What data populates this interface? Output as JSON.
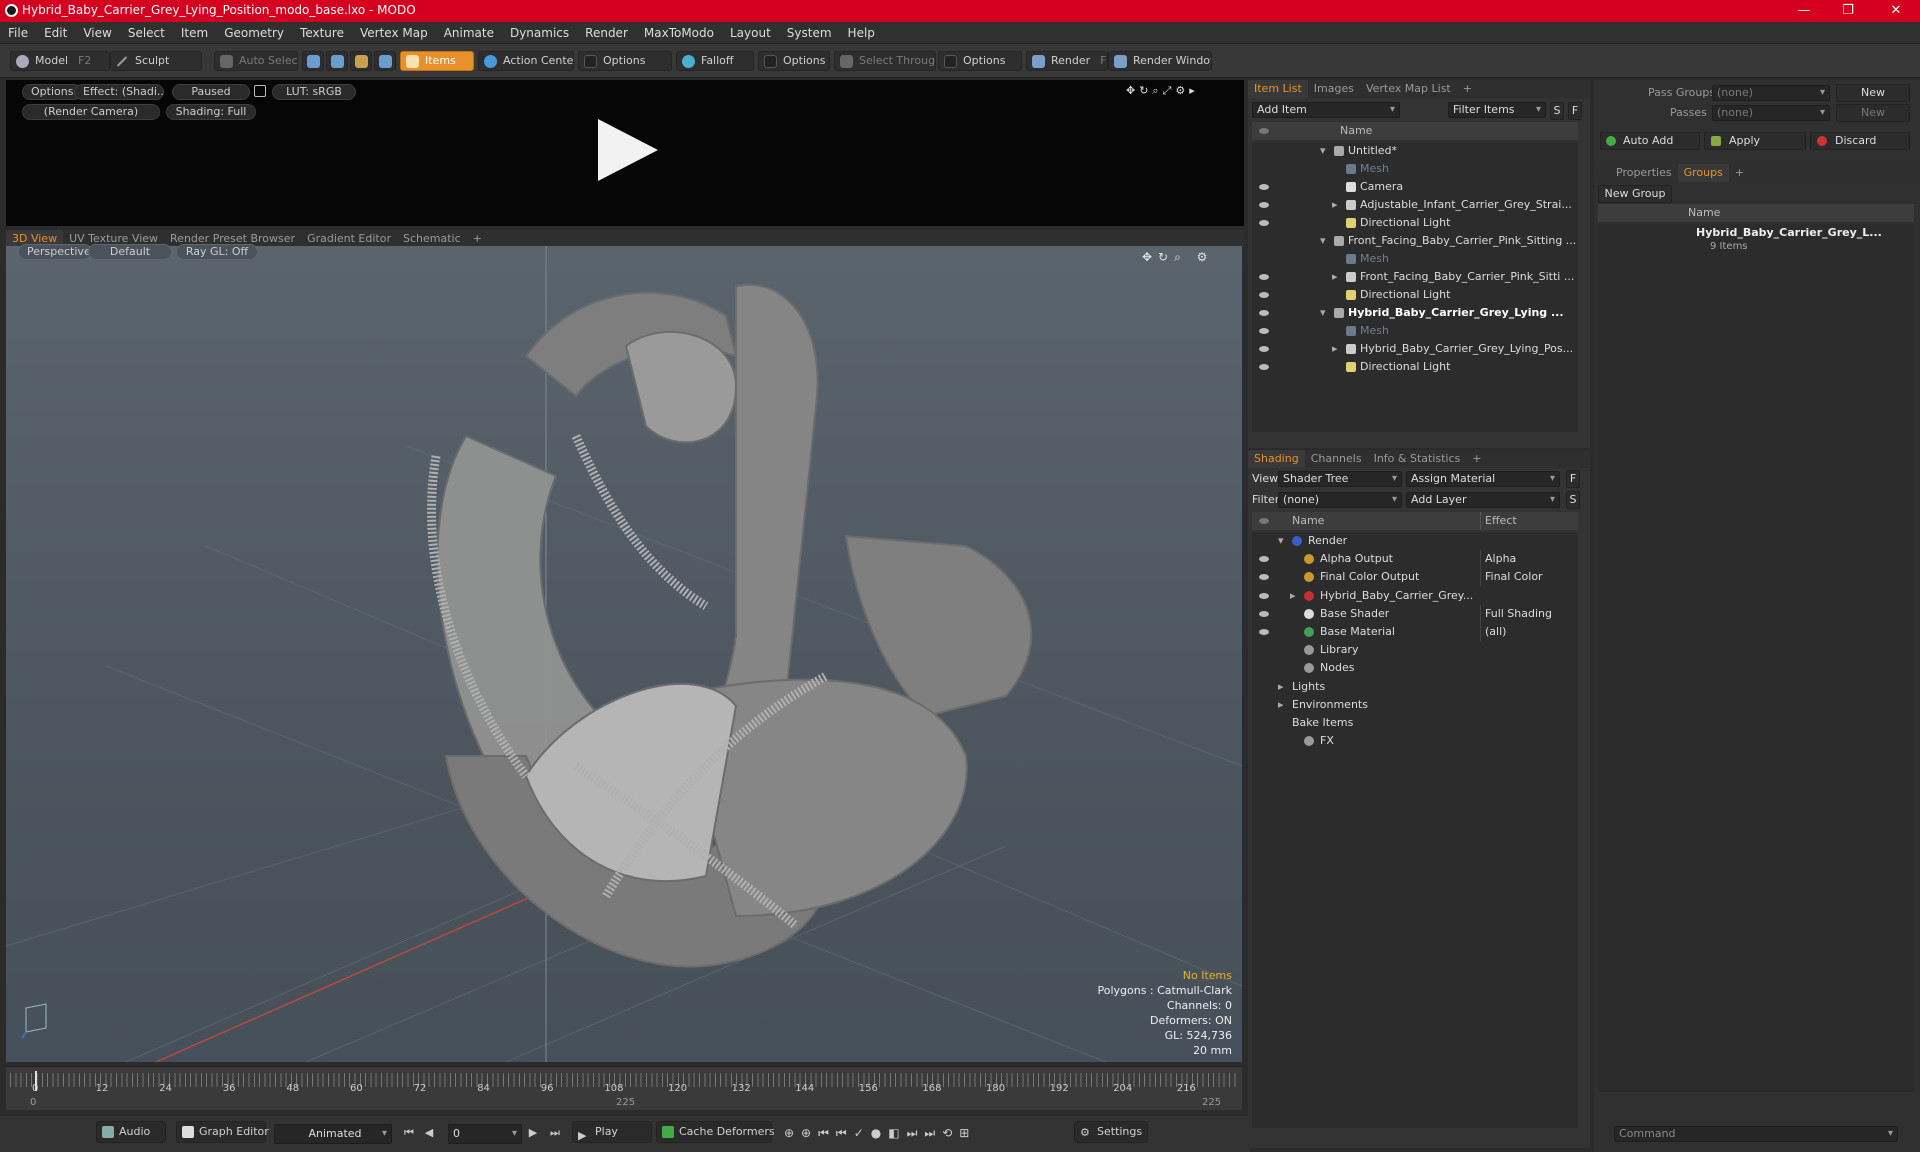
{
  "title": "Hybrid_Baby_Carrier_Grey_Lying_Position_modo_base.lxo - MODO",
  "window_controls": [
    "—",
    "❐",
    "✕"
  ],
  "menu": [
    "File",
    "Edit",
    "View",
    "Select",
    "Item",
    "Geometry",
    "Texture",
    "Vertex Map",
    "Animate",
    "Dynamics",
    "Render",
    "MaxToModo",
    "Layout",
    "System",
    "Help"
  ],
  "toolbar": {
    "model": "Model",
    "model_key": "F2",
    "sculpt": "Sculpt",
    "auto_select": "Auto Select",
    "items": "Items",
    "action_center": "Action Center",
    "options1": "Options",
    "falloff": "Falloff",
    "options2": "Options",
    "select_through": "Select Through",
    "options3": "Options",
    "render": "Render",
    "render_key": "F9",
    "render_window": "Render Window"
  },
  "preview": {
    "options": "Options",
    "effect": "Effect: (Shadi...",
    "paused": "Paused",
    "lut": "LUT: sRGB",
    "camera": "(Render Camera)",
    "shading": "Shading: Full"
  },
  "view_tabs": [
    "3D View",
    "UV Texture View",
    "Render Preset Browser",
    "Gradient Editor",
    "Schematic",
    "+"
  ],
  "view3d": {
    "perspective": "Perspective",
    "default": "Default",
    "raygl": "Ray GL: Off",
    "info": {
      "no_items": "No Items",
      "polygons": "Polygons : Catmull-Clark",
      "channels": "Channels: 0",
      "deformers": "Deformers: ON",
      "gl": "GL: 524,736",
      "size": "20 mm"
    }
  },
  "timeline": {
    "ticks": [
      "0",
      "12",
      "24",
      "36",
      "48",
      "60",
      "72",
      "84",
      "96",
      "108",
      "120",
      "132",
      "144",
      "156",
      "168",
      "180",
      "192",
      "204",
      "216"
    ],
    "left": "0",
    "mid": "225",
    "right": "225"
  },
  "bottom": {
    "audio": "Audio",
    "graph_editor": "Graph Editor",
    "animated": "Animated",
    "frame": "0",
    "play": "Play",
    "cache": "Cache Deformers",
    "settings": "Settings"
  },
  "item_list": {
    "tabs": [
      "Item List",
      "Images",
      "Vertex Map List",
      "+"
    ],
    "add_item": "Add Item",
    "filter": "Filter Items",
    "s": "S",
    "f": "F",
    "col_name": "Name",
    "rows": [
      {
        "label": "Untitled*",
        "indent": 0,
        "icon": "scene",
        "arrow": "▾",
        "vis": false
      },
      {
        "label": "Mesh",
        "indent": 1,
        "icon": "mesh",
        "arrow": "",
        "vis": false,
        "dim": true
      },
      {
        "label": "Camera",
        "indent": 1,
        "icon": "camera",
        "arrow": "",
        "vis": true
      },
      {
        "label": "Adjustable_Infant_Carrier_Grey_Strai...",
        "indent": 1,
        "icon": "group",
        "arrow": "▸",
        "vis": true
      },
      {
        "label": "Directional Light",
        "indent": 1,
        "icon": "light",
        "arrow": "",
        "vis": true
      },
      {
        "label": "Front_Facing_Baby_Carrier_Pink_Sitting ...",
        "indent": 0,
        "icon": "scene",
        "arrow": "▾",
        "vis": false
      },
      {
        "label": "Mesh",
        "indent": 1,
        "icon": "mesh",
        "arrow": "",
        "vis": false,
        "dim": true
      },
      {
        "label": "Front_Facing_Baby_Carrier_Pink_Sitti ...",
        "indent": 1,
        "icon": "group",
        "arrow": "▸",
        "vis": true
      },
      {
        "label": "Directional Light",
        "indent": 1,
        "icon": "light",
        "arrow": "",
        "vis": true
      },
      {
        "label": "Hybrid_Baby_Carrier_Grey_Lying ...",
        "indent": 0,
        "icon": "scene",
        "arrow": "▾",
        "vis": true,
        "bold": true
      },
      {
        "label": "Mesh",
        "indent": 1,
        "icon": "mesh",
        "arrow": "",
        "vis": true,
        "dim": true
      },
      {
        "label": "Hybrid_Baby_Carrier_Grey_Lying_Pos...",
        "indent": 1,
        "icon": "group",
        "arrow": "▸",
        "vis": true
      },
      {
        "label": "Directional Light",
        "indent": 1,
        "icon": "light",
        "arrow": "",
        "vis": true
      }
    ]
  },
  "shading": {
    "tabs": [
      "Shading",
      "Channels",
      "Info & Statistics",
      "+"
    ],
    "view_label": "View",
    "view_value": "Shader Tree",
    "assign": "Assign Material",
    "filter_label": "Filter",
    "filter_value": "(none)",
    "add_layer": "Add Layer",
    "f": "F",
    "s": "S",
    "col_name": "Name",
    "col_effect": "Effect",
    "rows": [
      {
        "label": "Render",
        "effect": "",
        "indent": 0,
        "arrow": "▾",
        "icon": "#3b5bc8",
        "vis": false
      },
      {
        "label": "Alpha Output",
        "effect": "Alpha",
        "indent": 1,
        "arrow": "",
        "icon": "#c89a30",
        "vis": true
      },
      {
        "label": "Final Color Output",
        "effect": "Final Color",
        "indent": 1,
        "arrow": "",
        "icon": "#c89a30",
        "vis": true
      },
      {
        "label": "Hybrid_Baby_Carrier_Grey...",
        "effect": "",
        "indent": 1,
        "arrow": "▸",
        "icon": "#c03030",
        "vis": true
      },
      {
        "label": "Base Shader",
        "effect": "Full Shading",
        "indent": 1,
        "arrow": "",
        "icon": "#dddddd",
        "vis": true
      },
      {
        "label": "Base Material",
        "effect": "(all)",
        "indent": 1,
        "arrow": "",
        "icon": "#3fa05a",
        "vis": true
      },
      {
        "label": "Library",
        "effect": "",
        "indent": 1,
        "arrow": "",
        "icon": "#9a9a9a",
        "vis": false
      },
      {
        "label": "Nodes",
        "effect": "",
        "indent": 1,
        "arrow": "",
        "icon": "#9a9a9a",
        "vis": false
      },
      {
        "label": "Lights",
        "effect": "",
        "indent": 0,
        "arrow": "▸",
        "icon": "",
        "vis": false
      },
      {
        "label": "Environments",
        "effect": "",
        "indent": 0,
        "arrow": "▸",
        "icon": "",
        "vis": false
      },
      {
        "label": "Bake Items",
        "effect": "",
        "indent": 0,
        "arrow": "",
        "icon": "",
        "vis": false
      },
      {
        "label": "FX",
        "effect": "",
        "indent": 1,
        "arrow": "",
        "icon": "#9a9a9a",
        "vis": false
      }
    ]
  },
  "pass": {
    "pass_groups": "Pass Groups",
    "passes": "Passes",
    "none1": "(none)",
    "none2": "(none)",
    "new1": "New",
    "new2": "New",
    "auto_add": "Auto Add",
    "apply": "Apply",
    "discard": "Discard"
  },
  "groups": {
    "tabs": [
      "Properties",
      "Groups",
      "+"
    ],
    "new_group": "New Group",
    "col_name": "Name",
    "item_name": "Hybrid_Baby_Carrier_Grey_L...",
    "item_count": "9 Items"
  },
  "command": {
    "placeholder": "Command"
  }
}
